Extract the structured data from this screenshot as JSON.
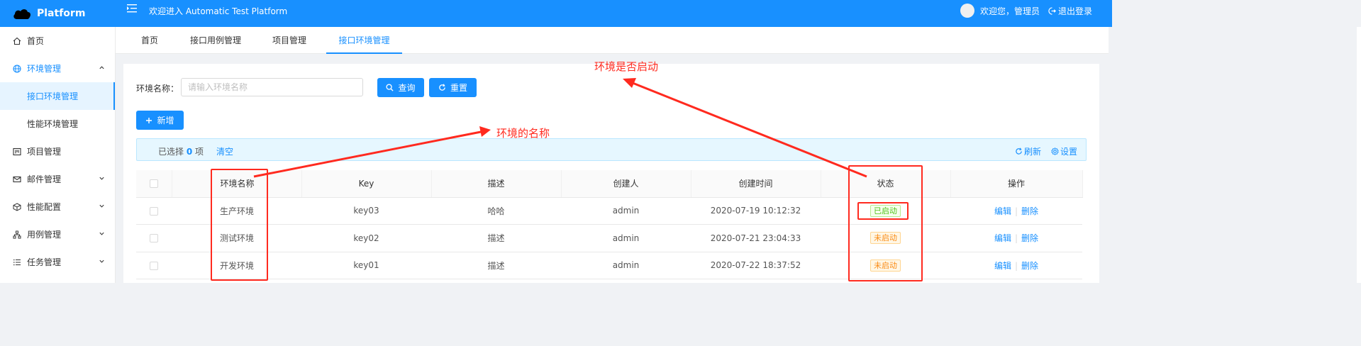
{
  "header": {
    "logo_text": "Platform",
    "welcome": "欢迎进入 Automatic Test Platform",
    "greeting": "欢迎您，管理员",
    "logout": "退出登录"
  },
  "sidebar": {
    "items": [
      {
        "label": "首页",
        "icon": "home-icon"
      },
      {
        "label": "环境管理",
        "icon": "globe-icon",
        "expanded": true
      },
      {
        "label": "接口环境管理",
        "selected": true
      },
      {
        "label": "性能环境管理"
      },
      {
        "label": "项目管理",
        "icon": "project-icon"
      },
      {
        "label": "邮件管理",
        "icon": "mail-icon"
      },
      {
        "label": "性能配置",
        "icon": "cube-icon"
      },
      {
        "label": "用例管理",
        "icon": "cluster-icon"
      },
      {
        "label": "任务管理",
        "icon": "list-icon"
      }
    ]
  },
  "tabs": [
    "首页",
    "接口用例管理",
    "项目管理",
    "接口环境管理"
  ],
  "search": {
    "label": "环境名称：",
    "placeholder": "请输入环境名称",
    "query_label": "查询",
    "reset_label": "重置"
  },
  "add_label": "新增",
  "alert": {
    "prefix": "已选择",
    "count": "0",
    "suffix": "项",
    "clear": "清空",
    "refresh": "刷新",
    "settings": "设置"
  },
  "table": {
    "headers": [
      "环境名称",
      "Key",
      "描述",
      "创建人",
      "创建时间",
      "状态",
      "操作"
    ],
    "rows": [
      {
        "name": "生产环境",
        "key": "key03",
        "desc": "哈哈",
        "creator": "admin",
        "created": "2020-07-19 10:12:32",
        "status": "已启动",
        "edit": "编辑",
        "delete": "删除"
      },
      {
        "name": "测试环境",
        "key": "key02",
        "desc": "描述",
        "creator": "admin",
        "created": "2020-07-21 23:04:33",
        "status": "未启动",
        "edit": "编辑",
        "delete": "删除"
      },
      {
        "name": "开发环境",
        "key": "key01",
        "desc": "描述",
        "creator": "admin",
        "created": "2020-07-22 18:37:52",
        "status": "未启动",
        "edit": "编辑",
        "delete": "删除"
      }
    ]
  },
  "annotations": {
    "status_note": "环境是否启动",
    "name_note": "环境的名称"
  },
  "colors": {
    "primary": "#1890ff",
    "annotation": "#ff2a1f",
    "success": "#52c41a",
    "warning": "#fa8c16"
  }
}
